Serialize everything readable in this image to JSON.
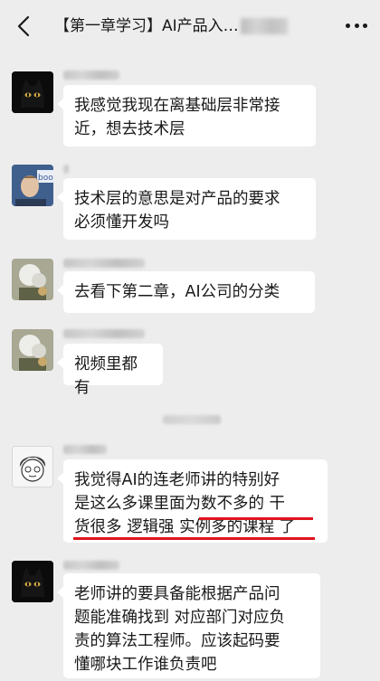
{
  "header": {
    "title": "【第一章学习】AI产品入…",
    "back_icon": "chevron-left-icon",
    "more_icon": "more-dots-icon"
  },
  "messages": [
    {
      "avatar": "black-cat-avatar",
      "lines": [
        "我感觉我现在离基础层非常接",
        "近，想去技术层"
      ]
    },
    {
      "avatar": "portrait-avatar",
      "lines": [
        "技术层的意思是对产品的要求",
        "必须懂开发吗"
      ]
    },
    {
      "avatar": "flower-avatar",
      "lines": [
        "去看下第二章，AI公司的分类"
      ]
    },
    {
      "avatar": "flower-avatar",
      "lines": [
        "视频里都有"
      ]
    },
    {
      "avatar": "cartoon-avatar",
      "lines": [
        "我觉得AI的连老师讲的特别好",
        "是这么多课里面为数不多的 干",
        "货很多 逻辑强 实例多的课程 了"
      ]
    },
    {
      "avatar": "black-cat-avatar",
      "lines": [
        "老师讲的要具备能根据产品问",
        "题能准确找到 对应部门对应负",
        "责的算法工程师。应该起码要",
        "懂哪块工作谁负责吧"
      ]
    }
  ],
  "colors": {
    "background": "#ededed",
    "bubble": "#ffffff",
    "highlight": "#e0141e"
  }
}
